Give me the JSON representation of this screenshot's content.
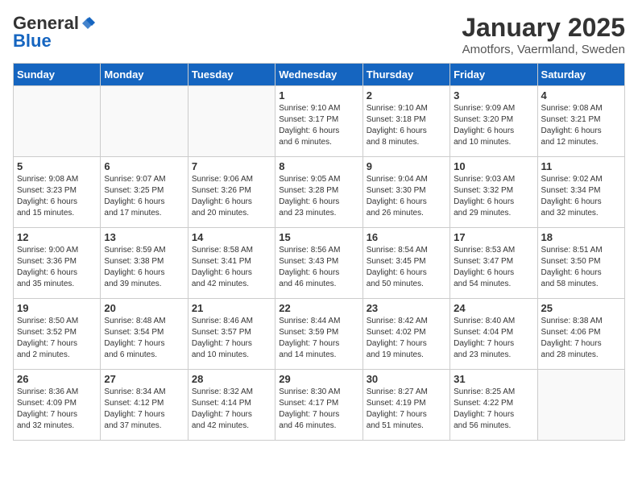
{
  "logo": {
    "general": "General",
    "blue": "Blue"
  },
  "header": {
    "title": "January 2025",
    "subtitle": "Amotfors, Vaermland, Sweden"
  },
  "days": [
    "Sunday",
    "Monday",
    "Tuesday",
    "Wednesday",
    "Thursday",
    "Friday",
    "Saturday"
  ],
  "weeks": [
    [
      {
        "day": "",
        "content": ""
      },
      {
        "day": "",
        "content": ""
      },
      {
        "day": "",
        "content": ""
      },
      {
        "day": "1",
        "content": "Sunrise: 9:10 AM\nSunset: 3:17 PM\nDaylight: 6 hours\nand 6 minutes."
      },
      {
        "day": "2",
        "content": "Sunrise: 9:10 AM\nSunset: 3:18 PM\nDaylight: 6 hours\nand 8 minutes."
      },
      {
        "day": "3",
        "content": "Sunrise: 9:09 AM\nSunset: 3:20 PM\nDaylight: 6 hours\nand 10 minutes."
      },
      {
        "day": "4",
        "content": "Sunrise: 9:08 AM\nSunset: 3:21 PM\nDaylight: 6 hours\nand 12 minutes."
      }
    ],
    [
      {
        "day": "5",
        "content": "Sunrise: 9:08 AM\nSunset: 3:23 PM\nDaylight: 6 hours\nand 15 minutes."
      },
      {
        "day": "6",
        "content": "Sunrise: 9:07 AM\nSunset: 3:25 PM\nDaylight: 6 hours\nand 17 minutes."
      },
      {
        "day": "7",
        "content": "Sunrise: 9:06 AM\nSunset: 3:26 PM\nDaylight: 6 hours\nand 20 minutes."
      },
      {
        "day": "8",
        "content": "Sunrise: 9:05 AM\nSunset: 3:28 PM\nDaylight: 6 hours\nand 23 minutes."
      },
      {
        "day": "9",
        "content": "Sunrise: 9:04 AM\nSunset: 3:30 PM\nDaylight: 6 hours\nand 26 minutes."
      },
      {
        "day": "10",
        "content": "Sunrise: 9:03 AM\nSunset: 3:32 PM\nDaylight: 6 hours\nand 29 minutes."
      },
      {
        "day": "11",
        "content": "Sunrise: 9:02 AM\nSunset: 3:34 PM\nDaylight: 6 hours\nand 32 minutes."
      }
    ],
    [
      {
        "day": "12",
        "content": "Sunrise: 9:00 AM\nSunset: 3:36 PM\nDaylight: 6 hours\nand 35 minutes."
      },
      {
        "day": "13",
        "content": "Sunrise: 8:59 AM\nSunset: 3:38 PM\nDaylight: 6 hours\nand 39 minutes."
      },
      {
        "day": "14",
        "content": "Sunrise: 8:58 AM\nSunset: 3:41 PM\nDaylight: 6 hours\nand 42 minutes."
      },
      {
        "day": "15",
        "content": "Sunrise: 8:56 AM\nSunset: 3:43 PM\nDaylight: 6 hours\nand 46 minutes."
      },
      {
        "day": "16",
        "content": "Sunrise: 8:54 AM\nSunset: 3:45 PM\nDaylight: 6 hours\nand 50 minutes."
      },
      {
        "day": "17",
        "content": "Sunrise: 8:53 AM\nSunset: 3:47 PM\nDaylight: 6 hours\nand 54 minutes."
      },
      {
        "day": "18",
        "content": "Sunrise: 8:51 AM\nSunset: 3:50 PM\nDaylight: 6 hours\nand 58 minutes."
      }
    ],
    [
      {
        "day": "19",
        "content": "Sunrise: 8:50 AM\nSunset: 3:52 PM\nDaylight: 7 hours\nand 2 minutes."
      },
      {
        "day": "20",
        "content": "Sunrise: 8:48 AM\nSunset: 3:54 PM\nDaylight: 7 hours\nand 6 minutes."
      },
      {
        "day": "21",
        "content": "Sunrise: 8:46 AM\nSunset: 3:57 PM\nDaylight: 7 hours\nand 10 minutes."
      },
      {
        "day": "22",
        "content": "Sunrise: 8:44 AM\nSunset: 3:59 PM\nDaylight: 7 hours\nand 14 minutes."
      },
      {
        "day": "23",
        "content": "Sunrise: 8:42 AM\nSunset: 4:02 PM\nDaylight: 7 hours\nand 19 minutes."
      },
      {
        "day": "24",
        "content": "Sunrise: 8:40 AM\nSunset: 4:04 PM\nDaylight: 7 hours\nand 23 minutes."
      },
      {
        "day": "25",
        "content": "Sunrise: 8:38 AM\nSunset: 4:06 PM\nDaylight: 7 hours\nand 28 minutes."
      }
    ],
    [
      {
        "day": "26",
        "content": "Sunrise: 8:36 AM\nSunset: 4:09 PM\nDaylight: 7 hours\nand 32 minutes."
      },
      {
        "day": "27",
        "content": "Sunrise: 8:34 AM\nSunset: 4:12 PM\nDaylight: 7 hours\nand 37 minutes."
      },
      {
        "day": "28",
        "content": "Sunrise: 8:32 AM\nSunset: 4:14 PM\nDaylight: 7 hours\nand 42 minutes."
      },
      {
        "day": "29",
        "content": "Sunrise: 8:30 AM\nSunset: 4:17 PM\nDaylight: 7 hours\nand 46 minutes."
      },
      {
        "day": "30",
        "content": "Sunrise: 8:27 AM\nSunset: 4:19 PM\nDaylight: 7 hours\nand 51 minutes."
      },
      {
        "day": "31",
        "content": "Sunrise: 8:25 AM\nSunset: 4:22 PM\nDaylight: 7 hours\nand 56 minutes."
      },
      {
        "day": "",
        "content": ""
      }
    ]
  ]
}
